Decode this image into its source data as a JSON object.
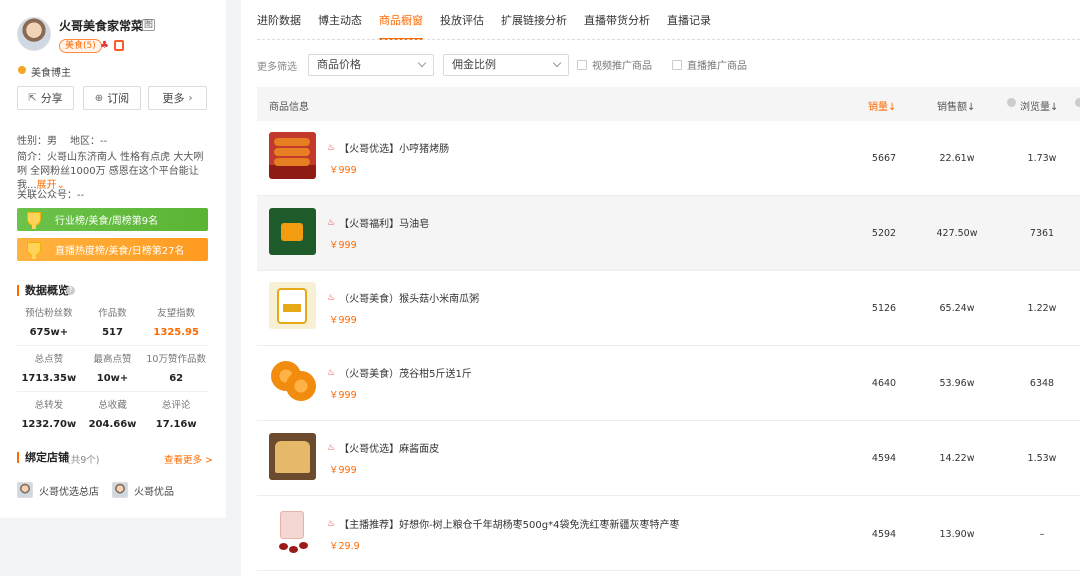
{
  "profile": {
    "name": "火哥美食家常菜",
    "name_badge": "图",
    "category_tag": "美食(5)",
    "verify_text": "美食博主",
    "buttons": {
      "share": "分享",
      "subscribe": "订阅",
      "more": "更多"
    },
    "gender_line": "性别：男",
    "region_line": "地区：--",
    "bio": "简介：火哥山东济南人 性格有点虎 大大咧咧 全网粉丝1000万 感恩在这个平台能让我...",
    "bio_more": "展开",
    "wechat_line": "关联公众号：--",
    "ranks": [
      {
        "label": "行业榜/美食/周榜第9名",
        "color": "#5ab534"
      },
      {
        "label": "直播热度榜/美食/日榜第27名",
        "color": "#ff9a1f"
      }
    ]
  },
  "overview": {
    "title": "数据概览",
    "stats": [
      {
        "label": "预估粉丝数",
        "value": "675w+"
      },
      {
        "label": "作品数",
        "value": "517"
      },
      {
        "label": "友望指数",
        "value": "1325.95",
        "highlight": true
      },
      {
        "label": "总点赞",
        "value": "1713.35w"
      },
      {
        "label": "最高点赞",
        "value": "10w+"
      },
      {
        "label": "10万赞作品数",
        "value": "62"
      },
      {
        "label": "总转发",
        "value": "1232.70w"
      },
      {
        "label": "总收藏",
        "value": "204.66w"
      },
      {
        "label": "总评论",
        "value": "17.16w"
      }
    ]
  },
  "shops": {
    "title": "绑定店铺",
    "count": "(共9个)",
    "more": "查看更多 >",
    "items": [
      "火哥优选总店",
      "火哥优品"
    ]
  },
  "tabs": {
    "items": [
      "进阶数据",
      "博主动态",
      "商品橱窗",
      "投放评估",
      "扩展链接分析",
      "直播带货分析",
      "直播记录"
    ],
    "active_index": 2
  },
  "filters": {
    "label": "更多筛选",
    "price_select": "商品价格",
    "commission_select": "佣金比例",
    "video_check": "视频推广商品",
    "live_check": "直播推广商品"
  },
  "table": {
    "headers": {
      "info": "商品信息",
      "sales": "销量↓",
      "revenue": "销售额↓",
      "views": "浏览量↓"
    },
    "rows": [
      {
        "title": "【火哥优选】小哼猪烤肠",
        "price": "￥999",
        "sales": "5667",
        "revenue": "22.61w",
        "views": "1.73w",
        "hover": false,
        "icon": "flame-icon"
      },
      {
        "title": "【火哥福利】马油皂",
        "price": "￥999",
        "sales": "5202",
        "revenue": "427.50w",
        "views": "7361",
        "hover": true,
        "icon": "flame-icon"
      },
      {
        "title": "（火哥美食）猴头菇小米南瓜粥",
        "price": "￥999",
        "sales": "5126",
        "revenue": "65.24w",
        "views": "1.22w",
        "hover": false,
        "icon": "flame-icon"
      },
      {
        "title": "（火哥美食）茂谷柑5斤送1斤",
        "price": "￥999",
        "sales": "4640",
        "revenue": "53.96w",
        "views": "6348",
        "hover": false,
        "icon": "flame-icon"
      },
      {
        "title": "【火哥优选】麻酱面皮",
        "price": "￥999",
        "sales": "4594",
        "revenue": "14.22w",
        "views": "1.53w",
        "hover": false,
        "icon": "flame-icon"
      },
      {
        "title": "【主播推荐】好想你-树上粮仓千年胡杨枣500g*4袋免洗红枣新疆灰枣特产枣",
        "price": "￥29.9",
        "sales": "4594",
        "revenue": "13.90w",
        "views": "–",
        "hover": false,
        "icon": "fire-icon"
      }
    ]
  }
}
